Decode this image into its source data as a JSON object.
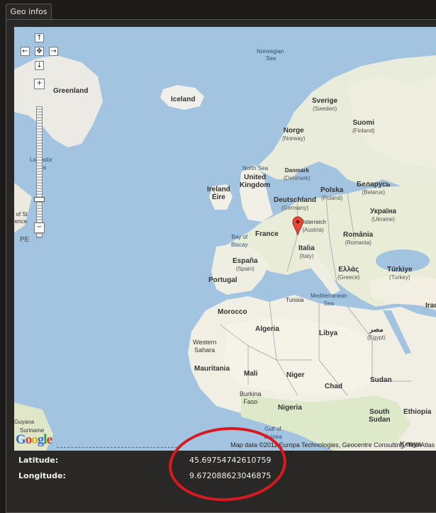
{
  "tab": {
    "label": "Geo infos"
  },
  "info": {
    "latitude_label": "Latitude:",
    "latitude_value": "45.69754742610759",
    "longitude_label": "Longitude:",
    "longitude_value": "9.672088623046875"
  },
  "map": {
    "attribution": "Map data ©2011 Europa Technologies, Geocentre Consulting, Tele Atlas",
    "logo": "Google",
    "pan_controls": {
      "up": "↑",
      "down": "↓",
      "left": "←",
      "right": "→",
      "center": "✥"
    },
    "zoom": {
      "in": "+",
      "out": "−"
    },
    "labels": {
      "greenland": "Greenland",
      "iceland": "Iceland",
      "norwegian_sea": "Norwegian",
      "norwegian_sea2": "Sea",
      "sverige": "Sverige",
      "sverige_sub": "(Sweden)",
      "suomi": "Suomi",
      "suomi_sub": "(Finland)",
      "norge": "Norge",
      "norge_sub": "(Norway)",
      "north_sea": "North Sea",
      "united_kingdom": "United",
      "united_kingdom2": "Kingdom",
      "danmark": "Danmark",
      "danmark_sub": "(Denmark)",
      "ireland": "Ireland",
      "eire": "Éire",
      "labrador": "Labrador",
      "labrador2": "Sea",
      "polska": "Polska",
      "polska_sub": "(Poland)",
      "belarus": "Беларусь",
      "belarus_sub": "(Belarus)",
      "deutschland": "Deutschland",
      "deutschland_sub": "(Germany)",
      "ukraina": "Україна",
      "ukraina_sub": "(Ukraine)",
      "osterreich": "Österreich",
      "osterreich_sub": "(Austria)",
      "france": "France",
      "romania": "România",
      "romania_sub": "(Romania)",
      "bay_biscay": "Bay of",
      "bay_biscay2": "Biscay",
      "italia": "Italia",
      "italia_sub": "(Italy)",
      "espana": "España",
      "espana_sub": "(Spain)",
      "ellas": "Ελλάς",
      "ellas_sub": "(Greece)",
      "turkiye": "Türkiye",
      "turkiye_sub": "(Turkey)",
      "portugal": "Portugal",
      "tunisia": "Tunisia",
      "mediterranean": "Mediterranean",
      "mediterranean2": "Sea",
      "morocco": "Morocco",
      "algeria": "Algeria",
      "libya": "Libya",
      "misr": "مصر",
      "misr_sub": "(Egypt)",
      "western_sahara": "Western",
      "western_sahara2": "Sahara",
      "mauritania": "Mauritania",
      "mali": "Mali",
      "niger": "Niger",
      "sudan": "Sudan",
      "chad": "Chad",
      "burkina": "Burkina",
      "burkina2": "Faso",
      "nigeria": "Nigeria",
      "south_sudan": "South",
      "south_sudan2": "Sudan",
      "ethiopia": "Ethiopia",
      "gulf_guinea": "Gulf of",
      "gulf_guinea2": "Guinea",
      "guyana": "Guyana",
      "suriname": "Suriname",
      "kenya": "Kenya",
      "iraq": "Irac",
      "pe": "PE",
      "of_st": "f of St",
      "rence": "rence"
    }
  }
}
